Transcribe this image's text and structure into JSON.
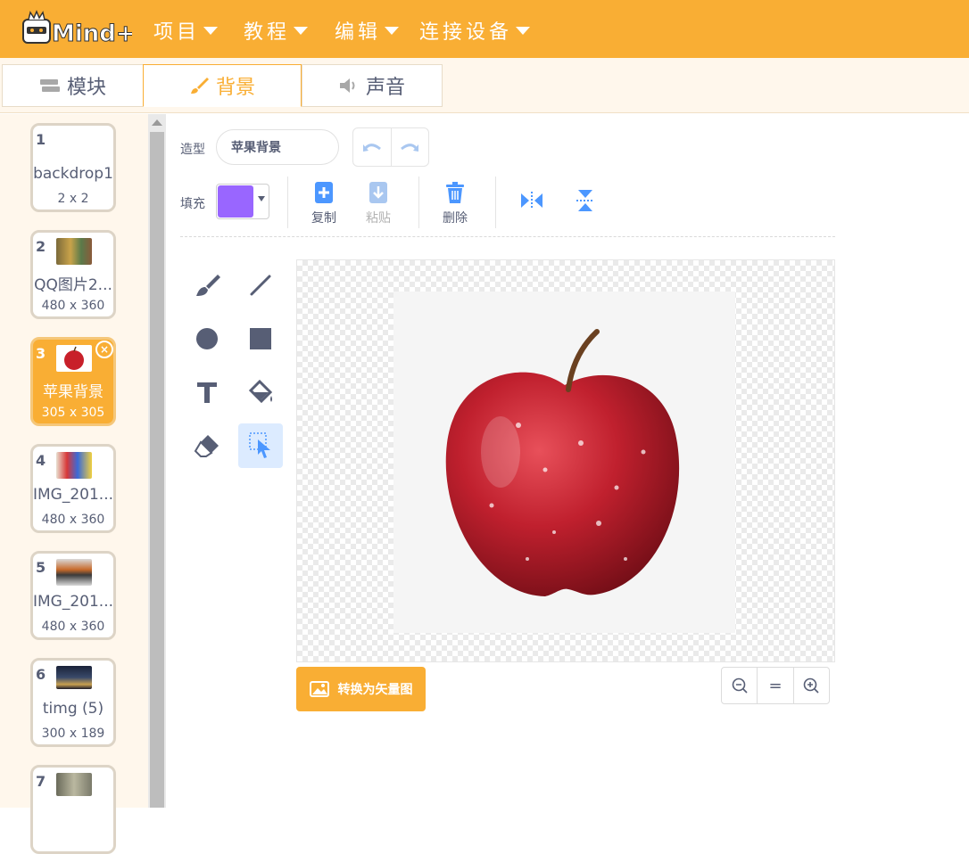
{
  "app": {
    "logo_text": "Mind+",
    "menu": [
      {
        "label": "项目"
      },
      {
        "label": "教程"
      },
      {
        "label": "编辑"
      },
      {
        "label": "连接设备"
      }
    ],
    "brand_color": "#f9ae34"
  },
  "tabs": [
    {
      "label": "模块",
      "icon": "blocks-icon",
      "active": false
    },
    {
      "label": "背景",
      "icon": "brush-icon",
      "active": true
    },
    {
      "label": "声音",
      "icon": "speaker-icon",
      "active": false
    }
  ],
  "costumes": [
    {
      "num": "1",
      "name": "backdrop1",
      "size": "2 x 2",
      "selected": false
    },
    {
      "num": "2",
      "name": "QQ图片2...",
      "size": "480 x 360",
      "selected": false
    },
    {
      "num": "3",
      "name": "苹果背景",
      "size": "305 x 305",
      "selected": true
    },
    {
      "num": "4",
      "name": "IMG_201...",
      "size": "480 x 360",
      "selected": false
    },
    {
      "num": "5",
      "name": "IMG_201...",
      "size": "480 x 360",
      "selected": false
    },
    {
      "num": "6",
      "name": "timg (5)",
      "size": "300 x 189",
      "selected": false
    },
    {
      "num": "7",
      "name": "",
      "size": "",
      "selected": false
    }
  ],
  "editor": {
    "costume_label": "造型",
    "costume_name": "苹果背景",
    "fill_label": "填充",
    "fill_color": "#9966ff",
    "actions": {
      "copy": "复制",
      "paste": "粘贴",
      "delete": "删除"
    },
    "convert_button": "转换为矢量图",
    "zoom": {
      "zoom_out": "−",
      "reset": "=",
      "zoom_in": "+"
    }
  }
}
